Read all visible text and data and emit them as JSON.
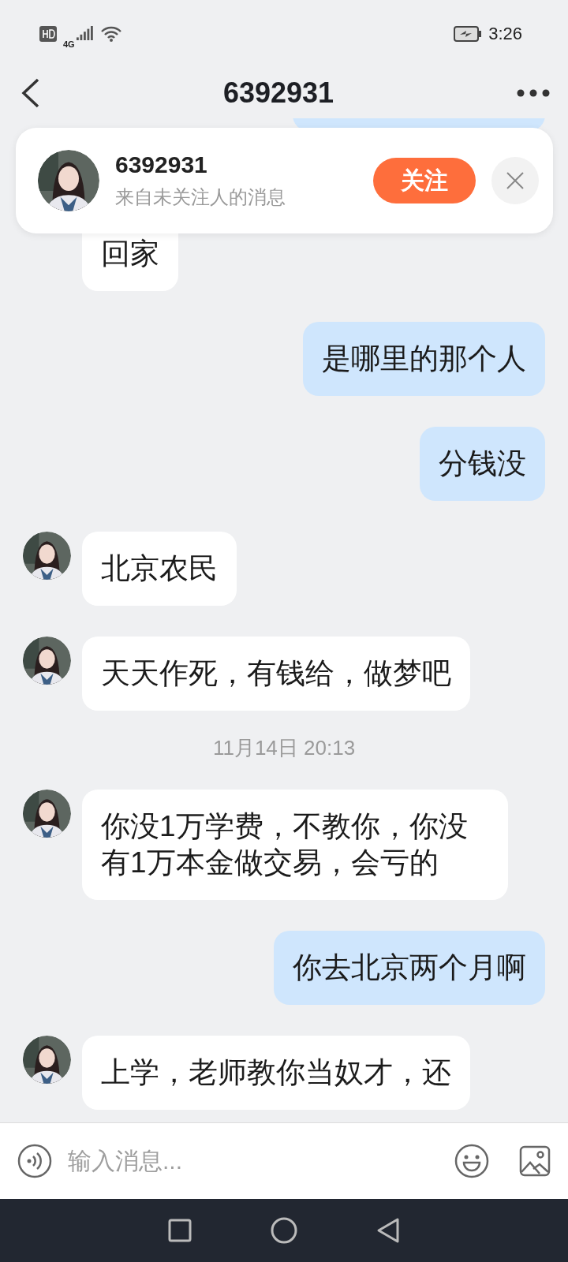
{
  "status_bar": {
    "network": "4G",
    "time": "3:26"
  },
  "header": {
    "title": "6392931"
  },
  "notice": {
    "name": "6392931",
    "subtitle": "来自未关注人的消息",
    "follow_label": "关注"
  },
  "messages": [
    {
      "kind": "sent"
    },
    {
      "kind": "received",
      "text": "回家"
    },
    {
      "kind": "sent",
      "text": "是哪里的那个人"
    },
    {
      "kind": "sent",
      "text": "分钱没"
    },
    {
      "kind": "received",
      "text": "北京农民",
      "avatar": true
    },
    {
      "kind": "received",
      "text": "天天作死，有钱给，做梦吧",
      "avatar": true
    },
    {
      "kind": "time",
      "text": "11月14日 20:13"
    },
    {
      "kind": "received",
      "text": "你没1万学费，不教你，你没有1万本金做交易，会亏的",
      "avatar": true
    },
    {
      "kind": "sent",
      "text": "你去北京两个月啊"
    },
    {
      "kind": "received",
      "text": "上学，老师教你当奴才，还",
      "avatar": true
    }
  ],
  "composer": {
    "placeholder": "输入消息..."
  }
}
